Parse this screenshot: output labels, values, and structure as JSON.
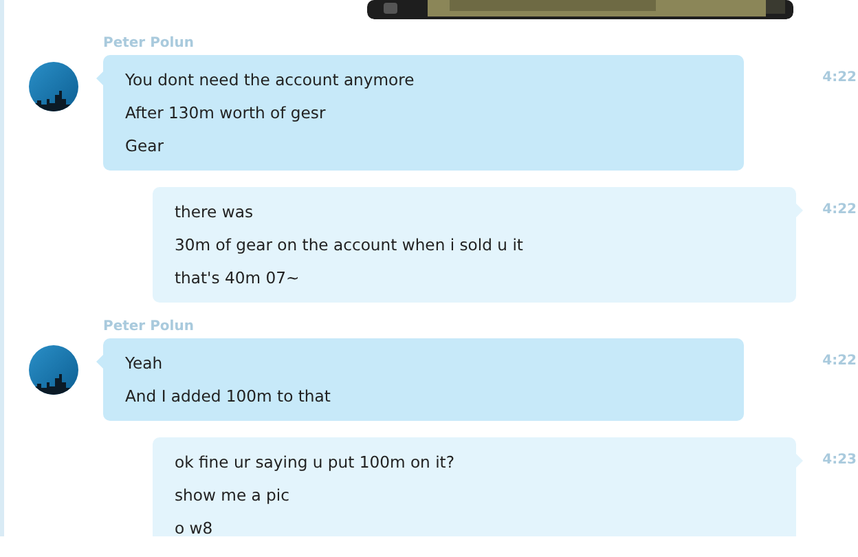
{
  "messages": [
    {
      "kind": "incoming",
      "sender": "Peter Polun",
      "lines": [
        "You dont need the account anymore",
        "After 130m worth of gesr",
        "Gear"
      ],
      "time": "4:22"
    },
    {
      "kind": "outgoing",
      "lines": [
        "there was",
        "30m of gear on the account when i sold u it",
        "that's 40m 07~"
      ],
      "time": "4:22"
    },
    {
      "kind": "incoming",
      "sender": "Peter Polun",
      "lines": [
        "Yeah",
        "And I added 100m to that"
      ],
      "time": "4:22"
    },
    {
      "kind": "outgoing",
      "lines": [
        "ok fine ur saying u put 100m on it?",
        "show me a pic",
        "o w8"
      ],
      "time": "4:23"
    }
  ]
}
